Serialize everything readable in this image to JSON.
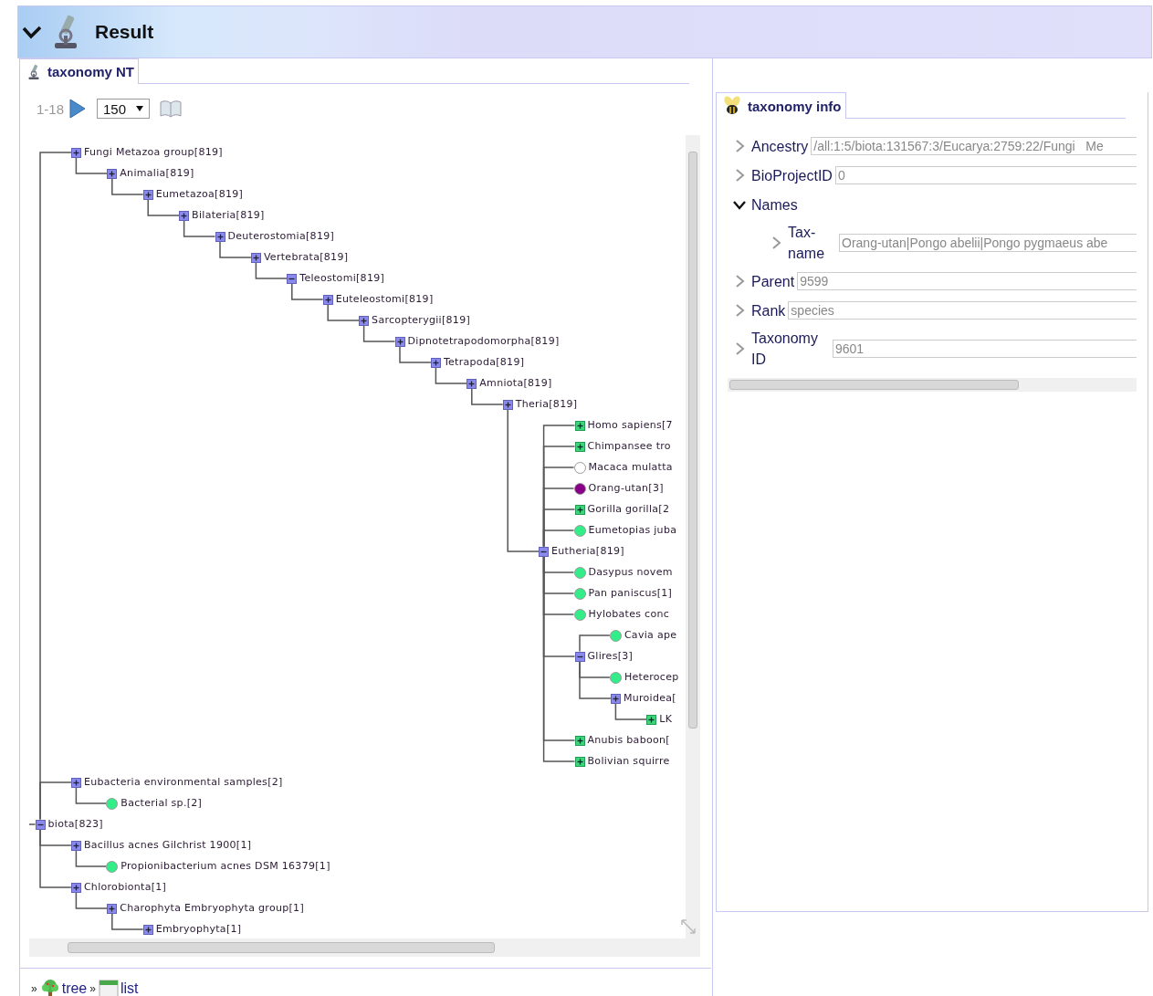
{
  "header": {
    "title": "Result",
    "expanded": true
  },
  "left_panel": {
    "tab": {
      "label": "taxonomy NT",
      "selected": true
    },
    "toolbar": {
      "range": "1-18",
      "page_size": "150"
    },
    "tree": {
      "root": {
        "label": "biota[823]",
        "kind": "group",
        "expanded": true,
        "children_above": [
          {
            "label": "Fungi Metazoa group[819]",
            "kind": "group",
            "expanded": false,
            "children": [
              {
                "label": "Animalia[819]",
                "kind": "group",
                "expanded": false,
                "children": [
                  {
                    "label": "Eumetazoa[819]",
                    "kind": "group",
                    "expanded": false,
                    "children": [
                      {
                        "label": "Bilateria[819]",
                        "kind": "group",
                        "expanded": false,
                        "children": [
                          {
                            "label": "Deuterostomia[819]",
                            "kind": "group",
                            "expanded": false,
                            "children": [
                              {
                                "label": "Vertebrata[819]",
                                "kind": "group",
                                "expanded": false,
                                "children": [
                                  {
                                    "label": "Teleostomi[819]",
                                    "kind": "group",
                                    "expanded": true,
                                    "children": [
                                      {
                                        "label": "Euteleostomi[819]",
                                        "kind": "group",
                                        "expanded": false,
                                        "children": [
                                          {
                                            "label": "Sarcopterygii[819]",
                                            "kind": "group",
                                            "expanded": false,
                                            "children": [
                                              {
                                                "label": "Dipnotetrapodomorpha[819]",
                                                "kind": "group",
                                                "expanded": false,
                                                "children": [
                                                  {
                                                    "label": "Tetrapoda[819]",
                                                    "kind": "group",
                                                    "expanded": false,
                                                    "children": [
                                                      {
                                                        "label": "Amniota[819]",
                                                        "kind": "group",
                                                        "expanded": false,
                                                        "children": [
                                                          {
                                                            "label": "Theria[819]",
                                                            "kind": "group",
                                                            "expanded": false,
                                                            "children": [
                                                              {
                                                                "label": "Eutheria[819]",
                                                                "kind": "group",
                                                                "expanded": true,
                                                                "children_above": [
                                                                  {
                                                                    "label": "Homo sapiens[7",
                                                                    "kind": "leaf-group"
                                                                  },
                                                                  {
                                                                    "label": "Chimpansee tro",
                                                                    "kind": "leaf-group"
                                                                  },
                                                                  {
                                                                    "label": "Macaca mulatta",
                                                                    "kind": "leaf",
                                                                    "color": "#ffffff"
                                                                  },
                                                                  {
                                                                    "label": "Orang-utan[3]",
                                                                    "kind": "leaf",
                                                                    "color": "#880088"
                                                                  },
                                                                  {
                                                                    "label": "Gorilla gorilla[2",
                                                                    "kind": "leaf-group"
                                                                  },
                                                                  {
                                                                    "label": "Eumetopias juba",
                                                                    "kind": "leaf",
                                                                    "color": "#33ee88"
                                                                  }
                                                                ],
                                                                "children": [
                                                                  {
                                                                    "label": "Dasypus novem",
                                                                    "kind": "leaf",
                                                                    "color": "#33ee88"
                                                                  },
                                                                  {
                                                                    "label": "Pan paniscus[1]",
                                                                    "kind": "leaf",
                                                                    "color": "#33ee88"
                                                                  },
                                                                  {
                                                                    "label": "Hylobates conc",
                                                                    "kind": "leaf",
                                                                    "color": "#33ee88"
                                                                  },
                                                                  {
                                                                    "label": "Glires[3]",
                                                                    "kind": "group",
                                                                    "expanded": true,
                                                                    "children_above": [
                                                                      {
                                                                        "label": "Cavia ape",
                                                                        "kind": "leaf",
                                                                        "color": "#33ee88"
                                                                      }
                                                                    ],
                                                                    "children": [
                                                                      {
                                                                        "label": "Heterocep",
                                                                        "kind": "leaf",
                                                                        "color": "#33ee88"
                                                                      },
                                                                      {
                                                                        "label": "Muroidea[",
                                                                        "kind": "group",
                                                                        "expanded": false,
                                                                        "children": [
                                                                          {
                                                                            "label": "LK",
                                                                            "kind": "leaf-group"
                                                                          }
                                                                        ]
                                                                      }
                                                                    ]
                                                                  },
                                                                  {
                                                                    "label": "Anubis baboon[",
                                                                    "kind": "leaf-group"
                                                                  },
                                                                  {
                                                                    "label": "Bolivian squirre",
                                                                    "kind": "leaf-group"
                                                                  }
                                                                ]
                                                              }
                                                            ]
                                                          }
                                                        ]
                                                      }
                                                    ]
                                                  }
                                                ]
                                              }
                                            ]
                                          }
                                        ]
                                      }
                                    ]
                                  }
                                ]
                              }
                            ]
                          }
                        ]
                      }
                    ]
                  }
                ]
              }
            ]
          },
          {
            "label": "Eubacteria environmental samples[2]",
            "kind": "group",
            "expanded": false,
            "children": [
              {
                "label": "Bacterial sp.[2]",
                "kind": "leaf",
                "color": "#33ee88"
              }
            ]
          }
        ],
        "children": [
          {
            "label": "Bacillus acnes Gilchrist 1900[1]",
            "kind": "group",
            "expanded": false,
            "children": [
              {
                "label": "Propionibacterium acnes DSM 16379[1]",
                "kind": "leaf",
                "color": "#33ee88"
              }
            ]
          },
          {
            "label": "Chlorobionta[1]",
            "kind": "group",
            "expanded": false,
            "children": [
              {
                "label": "Charophyta Embryophyta group[1]",
                "kind": "group",
                "expanded": false,
                "children": [
                  {
                    "label": "Embryophyta[1]",
                    "kind": "group",
                    "expanded": false
                  }
                ]
              }
            ]
          }
        ]
      }
    },
    "footer": {
      "links": [
        {
          "kind": "tree",
          "prefix": "»",
          "label": "tree"
        },
        {
          "kind": "list",
          "prefix": "»",
          "label": "list"
        }
      ]
    }
  },
  "info_panel": {
    "tab": {
      "label": "taxonomy info",
      "selected": true
    },
    "rows": [
      {
        "label": "Ancestry",
        "expanded": false,
        "value": "/all:1:5/biota:131567:3/Eucarya:2759:22/Fungi   Me"
      },
      {
        "label": "BioProjectID",
        "expanded": false,
        "value": "0"
      },
      {
        "label": "Names",
        "expanded": true,
        "children": [
          {
            "label": "Tax-name",
            "expanded": false,
            "value": "Orang-utan|Pongo abelii|Pongo pygmaeus abe"
          }
        ]
      },
      {
        "label": "Parent",
        "expanded": false,
        "value": "9599"
      },
      {
        "label": "Rank",
        "expanded": false,
        "value": "species"
      },
      {
        "label": "Taxonomy ID",
        "expanded": false,
        "value": "9601"
      }
    ]
  }
}
